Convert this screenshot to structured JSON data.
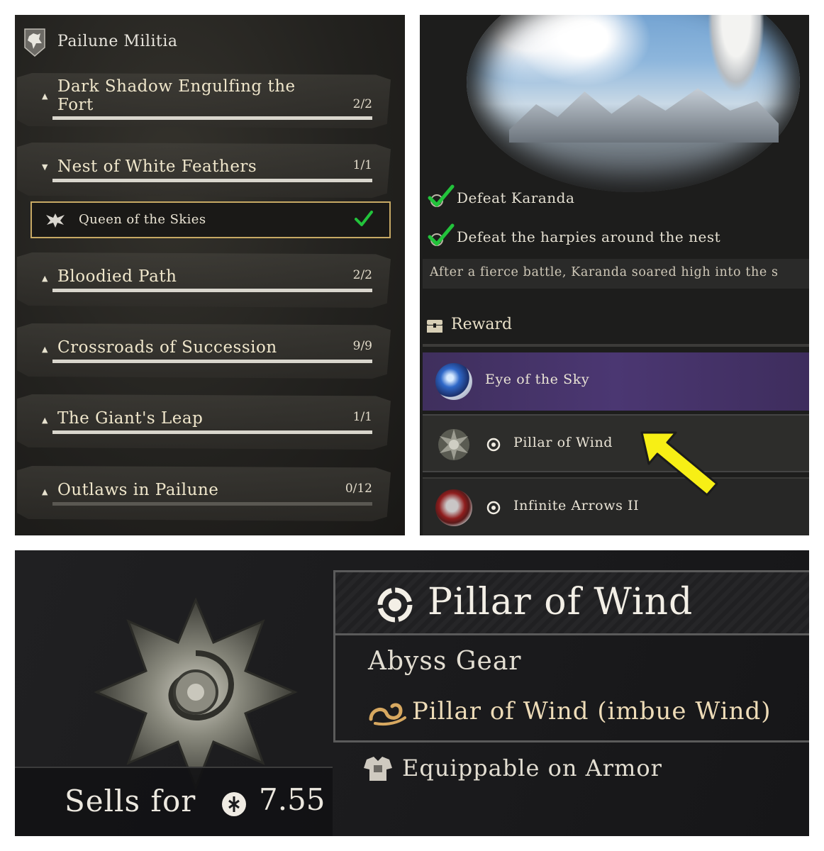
{
  "quests_panel": {
    "faction": "Pailune Militia",
    "quests": [
      {
        "title_line1": "Dark Shadow Engulfing the",
        "title_line2": "Fort",
        "count": "2/2",
        "progress": 1.0,
        "expanded": false
      },
      {
        "title_line1": "Nest of White Feathers",
        "count": "1/1",
        "progress": 1.0,
        "expanded": true
      },
      {
        "title_line1": "Bloodied Path",
        "count": "2/2",
        "progress": 1.0,
        "expanded": false
      },
      {
        "title_line1": "Crossroads of Succession",
        "count": "9/9",
        "progress": 1.0,
        "expanded": false
      },
      {
        "title_line1": "The Giant's Leap",
        "count": "1/1",
        "progress": 1.0,
        "expanded": false
      },
      {
        "title_line1": "Outlaws in Pailune",
        "count": "0/12",
        "progress": 0.0,
        "expanded": false
      }
    ],
    "selected_subquest": {
      "title": "Queen of the Skies",
      "completed": true
    }
  },
  "details_panel": {
    "objectives": [
      {
        "text": "Defeat Karanda",
        "completed": true
      },
      {
        "text": "Defeat the harpies around the nest",
        "completed": true
      }
    ],
    "description": "After a fierce battle, Karanda soared high into the s",
    "reward_label": "Reward",
    "rewards": [
      {
        "name": "Eye of the Sky",
        "rarity_color": "#4b3772"
      },
      {
        "name": "Pillar of Wind",
        "highlighted_by_arrow": true
      },
      {
        "name": "Infinite Arrows II"
      }
    ]
  },
  "item_panel": {
    "name": "Pillar of Wind",
    "category": "Abyss Gear",
    "effect": "Pillar of Wind (imbue Wind)",
    "equip_slot": "Equippable on Armor",
    "sells_for_label": "Sells for",
    "sells_for_value": "7.55"
  },
  "colors": {
    "accent_gold": "#c7a964",
    "check_green": "#22c33b",
    "arrow_yellow": "#f7ef15",
    "epic_purple": "#4b3772"
  }
}
